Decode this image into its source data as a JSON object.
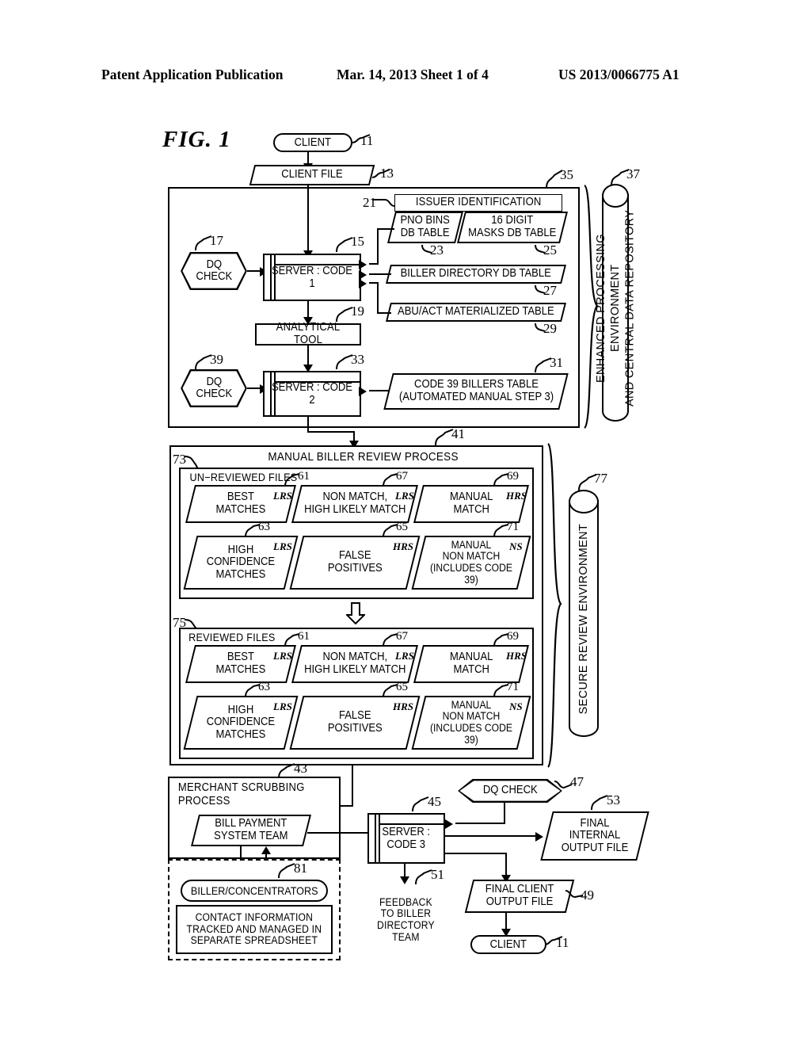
{
  "header": {
    "left": "Patent Application Publication",
    "middle": "Mar. 14, 2013  Sheet 1 of 4",
    "right": "US 2013/0066775 A1"
  },
  "figure": {
    "label": "FIG.  1"
  },
  "nodes": {
    "client_top": "CLIENT",
    "client_file": "CLIENT FILE",
    "dq_check_17": "DQ\nCHECK",
    "server_code1": "SERVER : CODE 1",
    "issuer_identification": "ISSUER IDENTIFICATION",
    "pno_bins": "PNO BINS\nDB TABLE",
    "digit_masks": "16 DIGIT\nMASKS DB TABLE",
    "biller_directory": "BILLER DIRECTORY DB TABLE",
    "abu_act": "ABU/ACT MATERIALIZED TABLE",
    "analytical_tool": "ANALYTICAL TOOL",
    "dq_check_39": "DQ\nCHECK",
    "server_code2": "SERVER : CODE 2",
    "code39_billers": "CODE 39 BILLERS TABLE\n(AUTOMATED MANUAL STEP 3)",
    "enhanced_env": "ENHANCED PROCESSING ENVIRONMENT\nAND CENTRAL DATA REPOSITORY",
    "manual_review_title": "MANUAL BILLER REVIEW PROCESS",
    "unreviewed_files": "UN−REVIEWED FILES",
    "reviewed_files": "REVIEWED FILES",
    "secure_review_env": "SECURE REVIEW ENVIRONMENT",
    "merchant_scrubbing": "MERCHANT SCRUBBING\nPROCESS",
    "bill_payment_team": "BILL PAYMENT\nSYSTEM TEAM",
    "biller_concentrators": "BILLER/CONCENTRATORS",
    "contact_info": "CONTACT INFORMATION\nTRACKED AND MANAGED IN\nSEPARATE SPREADSHEET",
    "server_code3": "SERVER :\nCODE 3",
    "feedback_biller": "FEEDBACK\nTO BILLER\nDIRECTORY\nTEAM",
    "dq_check_47": "DQ CHECK",
    "final_internal": "FINAL\nINTERNAL\nOUTPUT FILE",
    "final_client": "FINAL CLIENT\nOUTPUT FILE",
    "client_bottom": "CLIENT"
  },
  "file_boxes": [
    {
      "id": "61",
      "label": "BEST\nMATCHES",
      "tag": "LRS"
    },
    {
      "id": "67",
      "label": "NON MATCH,\nHIGH LIKELY MATCH",
      "tag": "LRS"
    },
    {
      "id": "69",
      "label": "MANUAL\nMATCH",
      "tag": "HRS"
    },
    {
      "id": "63",
      "label": "HIGH\nCONFIDENCE\nMATCHES",
      "tag": "LRS"
    },
    {
      "id": "65",
      "label": "FALSE\nPOSITIVES",
      "tag": "HRS"
    },
    {
      "id": "71",
      "label": "MANUAL\nNON MATCH\n(INCLUDES CODE 39)",
      "tag": "NS"
    }
  ],
  "refs": {
    "r11a": "11",
    "r13": "13",
    "r15": "15",
    "r17": "17",
    "r19": "19",
    "r21": "21",
    "r23": "23",
    "r25": "25",
    "r27": "27",
    "r29": "29",
    "r31": "31",
    "r33": "33",
    "r35": "35",
    "r37": "37",
    "r39": "39",
    "r41": "41",
    "r43": "43",
    "r45": "45",
    "r47": "47",
    "r49": "49",
    "r51": "51",
    "r53": "53",
    "r73": "73",
    "r75": "75",
    "r77": "77",
    "r81": "81",
    "r11b": "11",
    "u61": "61",
    "u67": "67",
    "u69": "69",
    "u63": "63",
    "u65": "65",
    "u71": "71",
    "v61": "61",
    "v67": "67",
    "v69": "69",
    "v63": "63",
    "v65": "65",
    "v71": "71"
  },
  "colors": {
    "ink": "#000000",
    "paper": "#ffffff"
  }
}
